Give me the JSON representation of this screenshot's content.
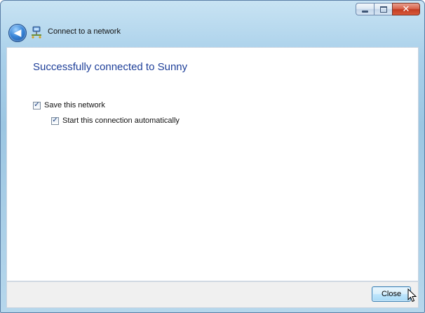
{
  "window": {
    "title": "Connect to a network",
    "controls": {
      "minimize": "minimize",
      "maximize": "maximize",
      "close": "✕"
    }
  },
  "nav": {
    "back_icon": "back-arrow-icon",
    "back_glyph": "◀"
  },
  "content": {
    "heading": "Successfully connected to Sunny",
    "options": [
      {
        "label": "Save this network",
        "checked": true
      },
      {
        "label": "Start this connection automatically",
        "checked": true
      }
    ]
  },
  "footer": {
    "close_label": "Close"
  },
  "icons": {
    "network": "network-icon",
    "cursor": "mouse-cursor-icon"
  },
  "colors": {
    "heading": "#1e3f99",
    "titlebar": "#a9d0ea",
    "close_red": "#c23d22"
  }
}
